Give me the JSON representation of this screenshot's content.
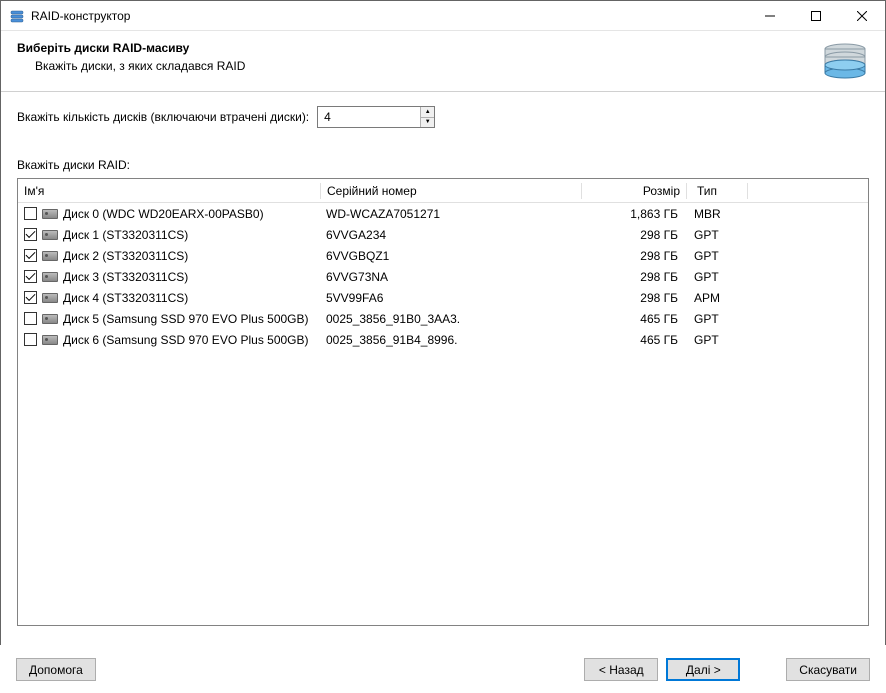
{
  "window": {
    "title": "RAID-конструктор"
  },
  "header": {
    "title": "Виберіть диски RAID-масиву",
    "subtitle": "Вкажіть диски, з яких складався RAID"
  },
  "disk_count": {
    "label": "Вкажіть кількість дисків (включаючи втрачені диски):",
    "value": "4"
  },
  "list_label": "Вкажіть диски RAID:",
  "columns": {
    "name": "Ім'я",
    "serial": "Серійний номер",
    "size": "Розмір",
    "type": "Тип"
  },
  "disks": [
    {
      "checked": false,
      "name": "Диск 0 (WDC WD20EARX-00PASB0)",
      "serial": "WD-WCAZA7051271",
      "size": "1,863 ГБ",
      "type": "MBR"
    },
    {
      "checked": true,
      "name": "Диск 1 (ST3320311CS)",
      "serial": "6VVGA234",
      "size": "298 ГБ",
      "type": "GPT"
    },
    {
      "checked": true,
      "name": "Диск 2 (ST3320311CS)",
      "serial": "6VVGBQZ1",
      "size": "298 ГБ",
      "type": "GPT"
    },
    {
      "checked": true,
      "name": "Диск 3 (ST3320311CS)",
      "serial": "6VVG73NA",
      "size": "298 ГБ",
      "type": "GPT"
    },
    {
      "checked": true,
      "name": "Диск 4 (ST3320311CS)",
      "serial": "5VV99FA6",
      "size": "298 ГБ",
      "type": "APM"
    },
    {
      "checked": false,
      "name": "Диск 5 (Samsung SSD 970 EVO Plus 500GB)",
      "serial": "0025_3856_91B0_3AA3.",
      "size": "465 ГБ",
      "type": "GPT"
    },
    {
      "checked": false,
      "name": "Диск 6 (Samsung SSD 970 EVO Plus 500GB)",
      "serial": "0025_3856_91B4_8996.",
      "size": "465 ГБ",
      "type": "GPT"
    }
  ],
  "buttons": {
    "help": "Допомога",
    "back": "< Назад",
    "next": "Далі >",
    "cancel": "Скасувати"
  }
}
